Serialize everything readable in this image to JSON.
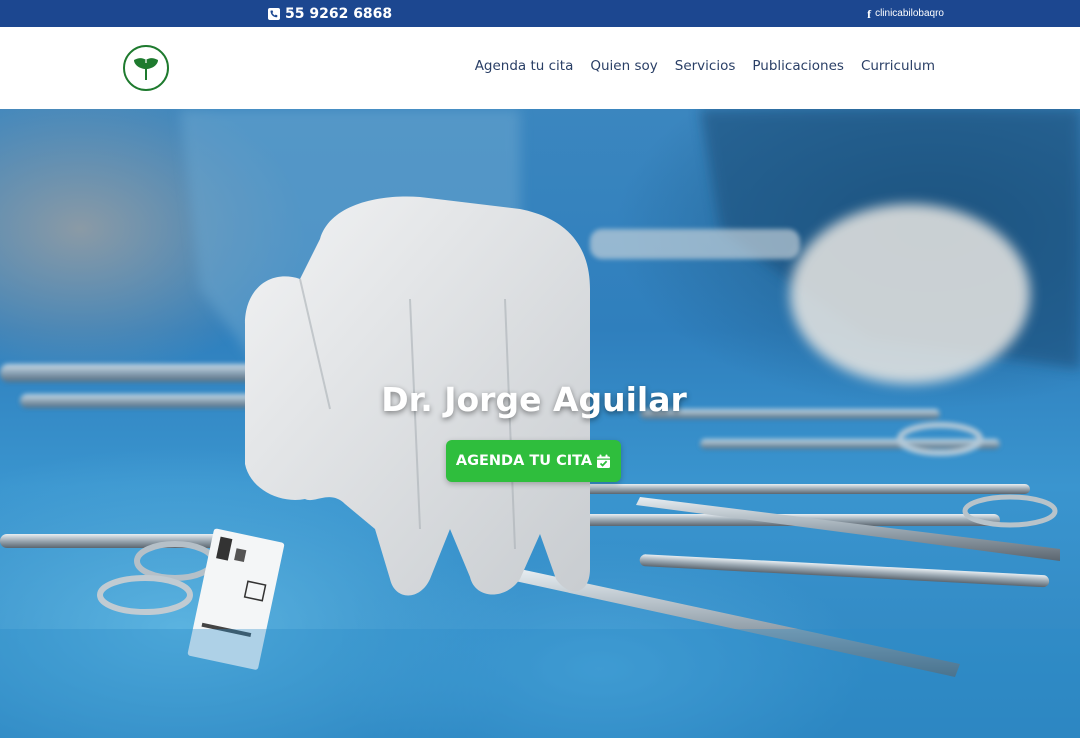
{
  "topbar": {
    "phone": "55 9262 6868",
    "phone_icon": "phone-square-icon",
    "social_handle": "clinicabilobaqro",
    "social_icon": "facebook-icon"
  },
  "header": {
    "logo_icon": "ginkgo-leaf-logo-icon",
    "nav": [
      {
        "label": "Agenda tu cita"
      },
      {
        "label": "Quien soy"
      },
      {
        "label": "Servicios"
      },
      {
        "label": "Publicaciones"
      },
      {
        "label": "Curriculum"
      }
    ]
  },
  "hero": {
    "title": "Dr. Jorge Aguilar",
    "cta_label": "AGENDA TU CITA",
    "cta_icon": "calendar-check-icon",
    "background": "surgical-gloved-hand-with-instruments-photo"
  },
  "colors": {
    "topbar": "#1c4790",
    "nav_text": "#2a3f66",
    "cta": "#2fbe3d",
    "logo": "#1e7a2e"
  }
}
